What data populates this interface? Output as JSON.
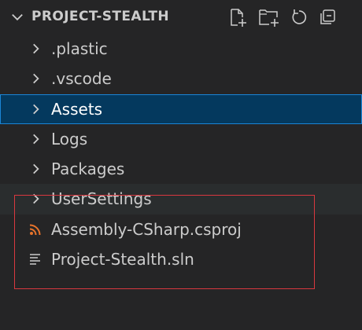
{
  "explorer": {
    "title": "PROJECT-STEALTH",
    "actions": [
      {
        "name": "new-file-icon"
      },
      {
        "name": "new-folder-icon"
      },
      {
        "name": "refresh-icon"
      },
      {
        "name": "collapse-all-icon"
      }
    ],
    "items": [
      {
        "label": ".plastic",
        "kind": "folder",
        "icon": "chevron-right-icon"
      },
      {
        "label": ".vscode",
        "kind": "folder",
        "icon": "chevron-right-icon"
      },
      {
        "label": "Assets",
        "kind": "folder",
        "icon": "chevron-right-icon",
        "selected": true
      },
      {
        "label": "Logs",
        "kind": "folder",
        "icon": "chevron-right-icon"
      },
      {
        "label": "Packages",
        "kind": "folder",
        "icon": "chevron-right-icon"
      },
      {
        "label": "UserSettings",
        "kind": "folder",
        "icon": "chevron-right-icon"
      },
      {
        "label": "Assembly-CSharp.csproj",
        "kind": "file",
        "icon": "rss-icon"
      },
      {
        "label": "Project-Stealth.sln",
        "kind": "file",
        "icon": "text-lines-icon"
      }
    ]
  },
  "colors": {
    "background": "#252526",
    "text": "#cccccc",
    "selection_bg": "#04395e",
    "selection_border": "#1a85d6",
    "csproj_icon": "#e8742b",
    "annotation_box": "#d9383f"
  }
}
